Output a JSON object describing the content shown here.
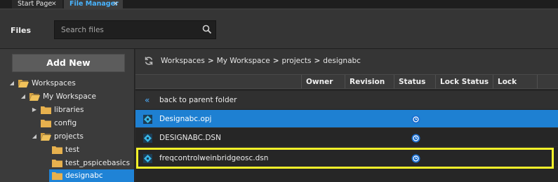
{
  "tabs": [
    {
      "label": "Start Page",
      "active": false
    },
    {
      "label": "File Manager",
      "active": true
    }
  ],
  "header": {
    "title": "Files",
    "search_placeholder": "Search files"
  },
  "sidebar": {
    "add_new_label": "Add New",
    "tree": [
      {
        "label": "Workspaces",
        "level": 0,
        "expanded": true,
        "selected": false
      },
      {
        "label": "My Workspace",
        "level": 1,
        "expanded": true,
        "selected": false
      },
      {
        "label": "libraries",
        "level": 2,
        "expanded": false,
        "selected": false
      },
      {
        "label": "config",
        "level": 2,
        "expanded": null,
        "selected": false
      },
      {
        "label": "projects",
        "level": 2,
        "expanded": true,
        "selected": false
      },
      {
        "label": "test",
        "level": 3,
        "expanded": null,
        "selected": false
      },
      {
        "label": "test_pspicebasics",
        "level": 3,
        "expanded": null,
        "selected": false
      },
      {
        "label": "designabc",
        "level": 3,
        "expanded": null,
        "selected": true
      }
    ]
  },
  "breadcrumb": [
    "Workspaces",
    "My Workspace",
    "projects",
    "designabc"
  ],
  "table": {
    "columns": [
      "Owner",
      "Revision",
      "Status",
      "Lock Status",
      "Lock Owner"
    ],
    "back_label": "back to parent folder",
    "rows": [
      {
        "name": "Designabc.opj",
        "selected": true,
        "status": "clock-status-icon"
      },
      {
        "name": "DESIGNABC.DSN",
        "selected": false,
        "status": "clock-status-icon"
      },
      {
        "name": "freqcontrolweinbridgeosc.dsn",
        "selected": false,
        "highlighted": true,
        "status": "clock-status-icon"
      }
    ]
  },
  "colors": {
    "accent": "#1e80d2",
    "active_tab_text": "#49b4ff",
    "highlight_border": "#f5f22a"
  }
}
